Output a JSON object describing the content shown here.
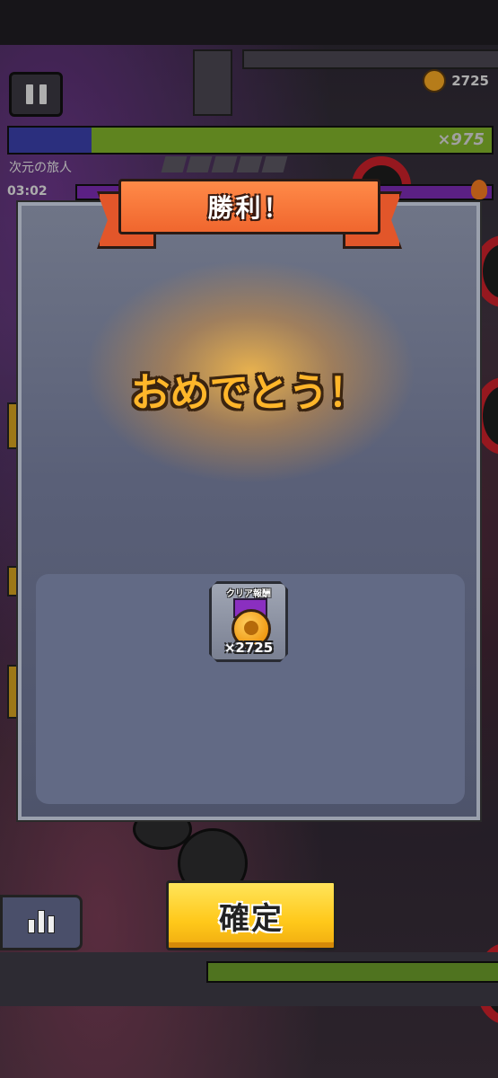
{
  "hud": {
    "coin_count": "2725",
    "boss_hp_count": "×975",
    "boss_name": "次元の旅人",
    "timer": "03:02"
  },
  "modal": {
    "banner_title": "勝利！",
    "congrats_text": "おめでとう！",
    "reward": {
      "label": "クリア報酬",
      "icon": "gold-medal-icon",
      "count": "×2725"
    }
  },
  "buttons": {
    "confirm_label": "確定",
    "stats_icon": "bar-chart-icon",
    "pause_icon": "pause-icon"
  },
  "colors": {
    "banner": "#f0662e",
    "congrats": "#ffb62a",
    "confirm": "#ffc81a",
    "modal_bg": "#5a6078"
  }
}
